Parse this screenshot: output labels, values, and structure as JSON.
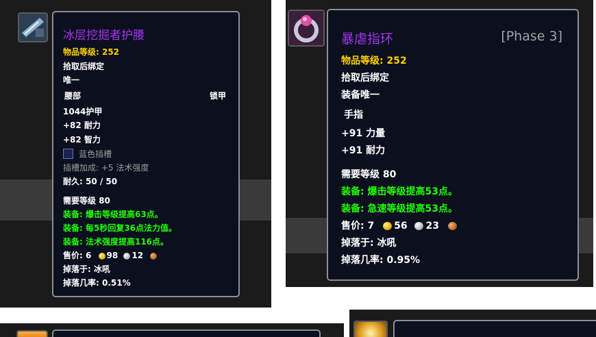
{
  "tooltip1": {
    "name": "冰层挖掘者护腰",
    "item_level": "物品等级: 252",
    "bind": "拾取后绑定",
    "unique": "唯一",
    "slot": "腰部",
    "armor_type": "锁甲",
    "armor": "1044护甲",
    "stamina": "+82 耐力",
    "intellect": "+82 智力",
    "socket": "蓝色插槽",
    "socket_bonus": "插槽加成: +5 法术强度",
    "durability": "耐久: 50 / 50",
    "required_level": "需要等级 80",
    "equip1": "装备: 爆击等级提高63点。",
    "equip2": "装备: 每5秒回复36点法力值。",
    "equip3": "装备: 法术强度提高116点。",
    "sell_label": "售价: 6",
    "sell_silver": "98",
    "sell_copper": "12",
    "drop_from": "掉落于: 冰吼",
    "drop_rate": "掉落几率: 0.51%"
  },
  "tooltip2": {
    "name": "暴虐指环",
    "phase": "[Phase 3]",
    "item_level": "物品等级: 252",
    "bind": "拾取后绑定",
    "unique": "装备唯一",
    "slot": "手指",
    "strength": "+91 力量",
    "stamina": "+91 耐力",
    "required_level": "需要等级 80",
    "equip1": "装备: 爆击等级提高53点。",
    "equip2": "装备: 急速等级提高53点。",
    "sell_label": "售价: 7",
    "sell_silver": "56",
    "sell_copper": "23",
    "drop_from": "掉落于: 冰吼",
    "drop_rate": "掉落几率: 0.95%"
  },
  "icons": {
    "item1": "belt-icon",
    "item2": "ring-icon",
    "item3": "item-icon",
    "item4": "item-icon"
  },
  "colors": {
    "epic": "#a335ee",
    "item_level": "#ffd100",
    "equip": "#1eff00",
    "disabled": "#9d9d9d"
  }
}
